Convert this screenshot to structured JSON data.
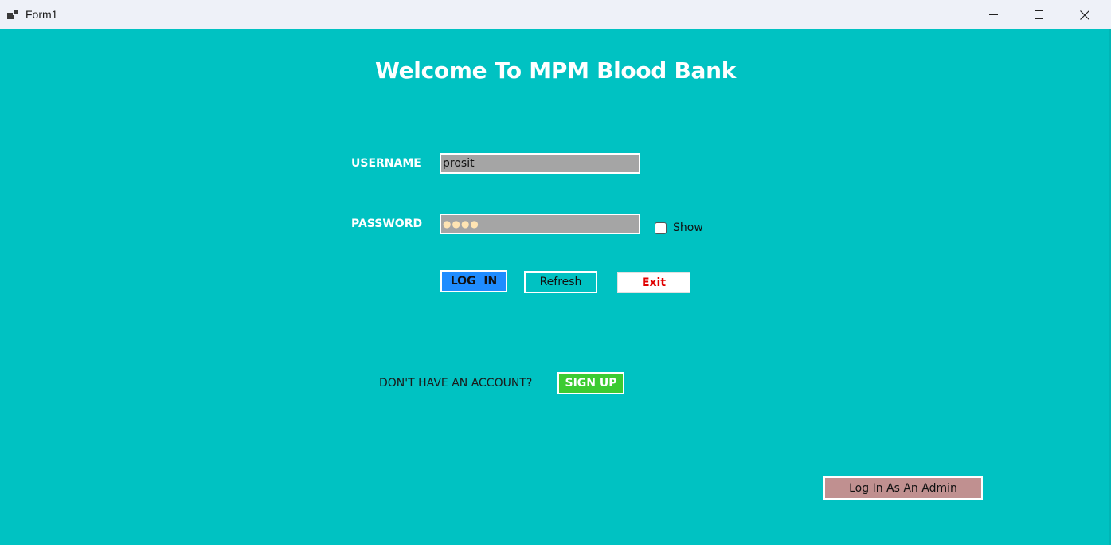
{
  "window": {
    "title": "Form1",
    "controls": {
      "minimize": "minimize",
      "maximize": "maximize",
      "close": "close"
    }
  },
  "form": {
    "heading": "Welcome To MPM Blood Bank",
    "username": {
      "label": "USERNAME",
      "value": "prosit"
    },
    "password": {
      "label": "PASSWORD",
      "masked_value": "●●●●"
    },
    "show_checkbox": {
      "label": "Show",
      "checked": false
    },
    "buttons": {
      "login": "LOG  IN",
      "refresh": "Refresh",
      "exit": "Exit"
    },
    "signup": {
      "prompt": "DON'T HAVE AN ACCOUNT?",
      "button": "SIGN UP"
    },
    "admin_button": "Log In As An Admin"
  },
  "colors": {
    "background": "#00c2c2",
    "login_button": "#1f8cff",
    "signup_button": "#3ccb32",
    "exit_text": "#e00000",
    "admin_button": "#c09090",
    "field_background": "#a5a5a5"
  }
}
